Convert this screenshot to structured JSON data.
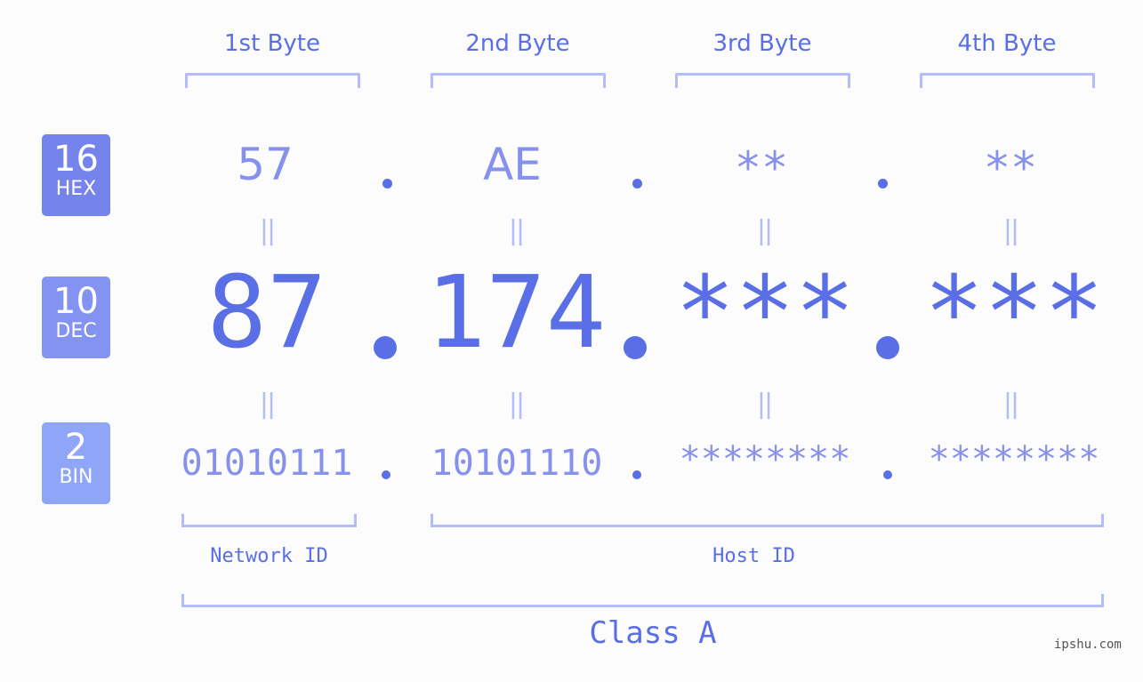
{
  "ip_address": "87.174.***.***",
  "headers": [
    "1st Byte",
    "2nd Byte",
    "3rd Byte",
    "4th Byte"
  ],
  "badges": [
    {
      "num": "16",
      "label": "HEX",
      "color": "#7484ec"
    },
    {
      "num": "10",
      "label": "DEC",
      "color": "#8493f1"
    },
    {
      "num": "2",
      "label": "BIN",
      "color": "#8fa6f8"
    }
  ],
  "hex": [
    "57",
    "AE",
    "**",
    "**"
  ],
  "dec": [
    "87",
    "174",
    "***",
    "***"
  ],
  "bin": [
    "01010111",
    "10101110",
    "********",
    "********"
  ],
  "equals_sign": "||",
  "separator": ".",
  "network_label": "Network ID",
  "host_label": "Host ID",
  "class_label": "Class A",
  "watermark": "ipshu.com",
  "colors": {
    "primary": "#5a6ee6",
    "secondary": "#8591ec",
    "bracket": "#b3bcf7",
    "background": "#fbfcfb"
  }
}
